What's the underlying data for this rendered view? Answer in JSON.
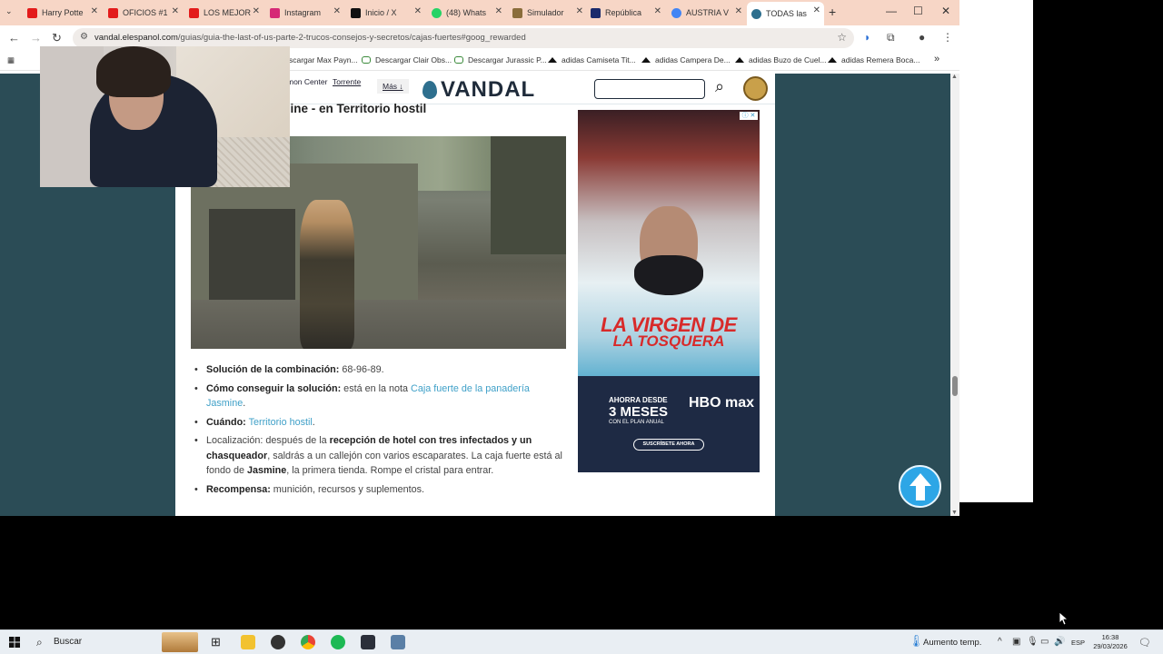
{
  "browser": {
    "tabs": [
      {
        "title": "Harry Potte",
        "favicon_color": "#e31b1b"
      },
      {
        "title": "OFICIOS #1",
        "favicon_color": "#e31b1b"
      },
      {
        "title": "LOS MEJOR",
        "favicon_color": "#e31b1b"
      },
      {
        "title": "Instagram",
        "favicon_color": "#d62976"
      },
      {
        "title": "Inicio / X",
        "favicon_color": "#111111"
      },
      {
        "title": "(48) Whats",
        "favicon_color": "#25d366"
      },
      {
        "title": "Simulador",
        "favicon_color": "#8a6d3b"
      },
      {
        "title": "República",
        "favicon_color": "#1a2a6c"
      },
      {
        "title": "AUSTRIA V",
        "favicon_color": "#4285f4"
      },
      {
        "title": "TODAS las",
        "favicon_color": "#2e6f8e"
      }
    ],
    "url_domain": "vandal.elespanol.com",
    "url_path": "/guias/guia-the-last-of-us-parte-2-trucos-consejos-y-secretos/cajas-fuertes#goog_rewarded",
    "bookmarks": [
      "scargar Max Payn...",
      "Descargar Clair Obs...",
      "Descargar Jurassic P...",
      "adidas Camiseta Tit...",
      "adidas Campera De...",
      "adidas Buzo de Cuel...",
      "adidas Remera Boca..."
    ],
    "bookmarks_more": "»"
  },
  "site": {
    "nav_common": "mon Center",
    "nav_torrente": "Torrente",
    "nav_more": "Más ↓",
    "logo": "VANDAL",
    "article_title": "smine - en Territorio hostil"
  },
  "facts": [
    {
      "label": "Solución de la combinación:",
      "text": " 68-96-89."
    },
    {
      "label": "Cómo conseguir la solución:",
      "text": " está en la nota ",
      "link": "Caja fuerte de la panadería Jasmine",
      "after": "."
    },
    {
      "label": "Cuándo:",
      "text": " ",
      "link": "Territorio hostil",
      "after": "."
    },
    {
      "location_prefix": "Localización: después de la ",
      "bold1": "recepción de hotel con tres infectados y un chasqueador",
      "mid": ", saldrás a un callejón con varios escaparates. La caja fuerte está al fondo de ",
      "bold2": "Jasmine",
      "end": ", la primera tienda. Rompe el cristal para entrar."
    },
    {
      "label": "Recompensa:",
      "text": " munición, recursos y suplementos."
    }
  ],
  "ad": {
    "title_line1": "LA VIRGEN DE",
    "title_line2": "LA TOSQUERA",
    "promo_small": "AHORRA DESDE",
    "promo_big": "3 MESES",
    "promo_plan": "CON EL PLAN ANUAL",
    "brand": "HBO max",
    "cta": "SUSCRÍBETE AHORA"
  },
  "taskbar": {
    "search": "Buscar",
    "weather": "Aumento temp.",
    "lang": "ESP",
    "time": "16:38",
    "date": "29/03/2026"
  }
}
